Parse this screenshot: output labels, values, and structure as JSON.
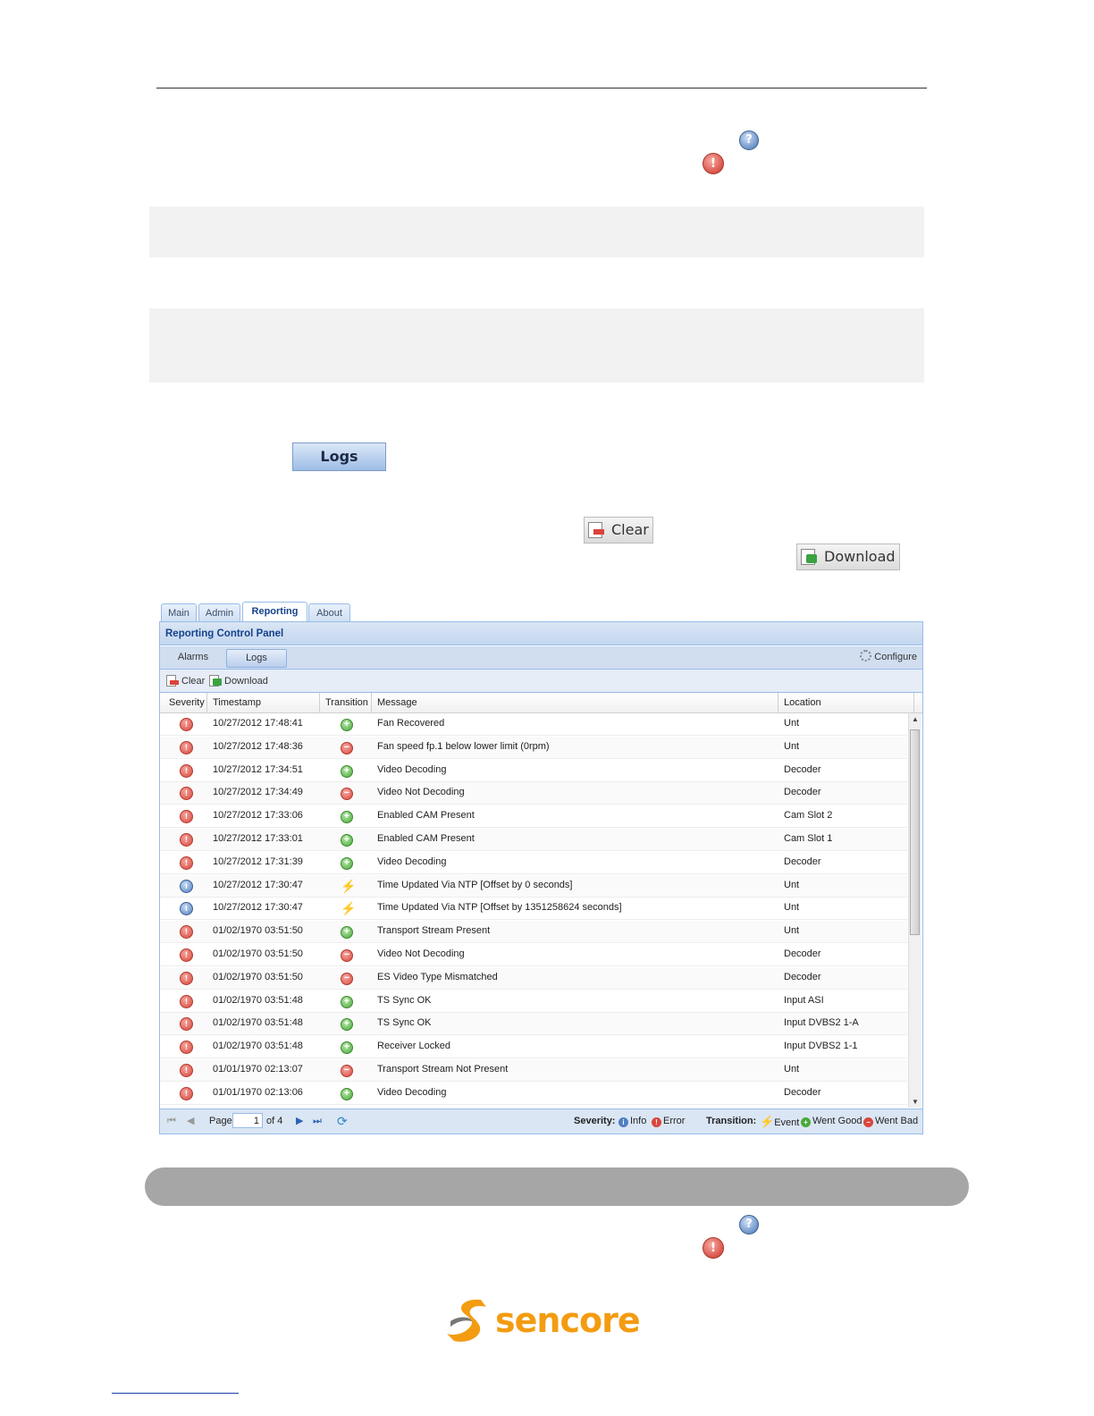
{
  "toolbar_buttons": {
    "logs_label": "Logs",
    "clear_label": "Clear",
    "download_label": "Download"
  },
  "icons": {
    "help": "help-icon",
    "alarm": "alarm-error-icon"
  },
  "panel": {
    "tabs": [
      "Main",
      "Admin",
      "Reporting",
      "About"
    ],
    "active_tab": "Reporting",
    "title": "Reporting Control Panel",
    "subtabs": [
      "Alarms",
      "Logs"
    ],
    "active_subtab": "Logs",
    "configure_label": "Configure",
    "clear_label": "Clear",
    "download_label": "Download",
    "columns": [
      "Severity",
      "Timestamp",
      "Transition",
      "Message",
      "Location"
    ],
    "rows": [
      {
        "severity": "error",
        "timestamp": "10/27/2012 17:48:41",
        "transition": "good",
        "message": "Fan Recovered",
        "location": "Unt"
      },
      {
        "severity": "error",
        "timestamp": "10/27/2012 17:48:36",
        "transition": "bad",
        "message": "Fan speed fp.1 below lower limit (0rpm)",
        "location": "Unt"
      },
      {
        "severity": "error",
        "timestamp": "10/27/2012 17:34:51",
        "transition": "good",
        "message": "Video Decoding",
        "location": "Decoder"
      },
      {
        "severity": "error",
        "timestamp": "10/27/2012 17:34:49",
        "transition": "bad",
        "message": "Video Not Decoding",
        "location": "Decoder"
      },
      {
        "severity": "error",
        "timestamp": "10/27/2012 17:33:06",
        "transition": "good",
        "message": "Enabled CAM Present",
        "location": "Cam Slot 2"
      },
      {
        "severity": "error",
        "timestamp": "10/27/2012 17:33:01",
        "transition": "good",
        "message": "Enabled CAM Present",
        "location": "Cam Slot 1"
      },
      {
        "severity": "error",
        "timestamp": "10/27/2012 17:31:39",
        "transition": "good",
        "message": "Video Decoding",
        "location": "Decoder"
      },
      {
        "severity": "info",
        "timestamp": "10/27/2012 17:30:47",
        "transition": "event",
        "message": "Time Updated Via NTP [Offset by 0 seconds]",
        "location": "Unt"
      },
      {
        "severity": "info",
        "timestamp": "10/27/2012 17:30:47",
        "transition": "event",
        "message": "Time Updated Via NTP [Offset by 1351258624 seconds]",
        "location": "Unt"
      },
      {
        "severity": "error",
        "timestamp": "01/02/1970 03:51:50",
        "transition": "good",
        "message": "Transport Stream Present",
        "location": "Unt"
      },
      {
        "severity": "error",
        "timestamp": "01/02/1970 03:51:50",
        "transition": "bad",
        "message": "Video Not Decoding",
        "location": "Decoder"
      },
      {
        "severity": "error",
        "timestamp": "01/02/1970 03:51:50",
        "transition": "bad",
        "message": "ES Video Type Mismatched",
        "location": "Decoder"
      },
      {
        "severity": "error",
        "timestamp": "01/02/1970 03:51:48",
        "transition": "good",
        "message": "TS Sync OK",
        "location": "Input ASI"
      },
      {
        "severity": "error",
        "timestamp": "01/02/1970 03:51:48",
        "transition": "good",
        "message": "TS Sync OK",
        "location": "Input DVBS2 1-A"
      },
      {
        "severity": "error",
        "timestamp": "01/02/1970 03:51:48",
        "transition": "good",
        "message": "Receiver Locked",
        "location": "Input DVBS2 1-1"
      },
      {
        "severity": "error",
        "timestamp": "01/01/1970 02:13:07",
        "transition": "bad",
        "message": "Transport Stream Not Present",
        "location": "Unt"
      },
      {
        "severity": "error",
        "timestamp": "01/01/1970 02:13:06",
        "transition": "good",
        "message": "Video Decoding",
        "location": "Decoder"
      }
    ],
    "pager": {
      "page_label": "Page",
      "page_value": "1",
      "of_label": "of 4"
    },
    "legend": {
      "severity_label": "Severity:",
      "info_label": "Info",
      "error_label": "Error",
      "transition_label": "Transition:",
      "event_label": "Event",
      "good_label": "Went Good",
      "bad_label": "Went Bad"
    }
  },
  "logo": {
    "text": "sencore.",
    "color": "#f39c12"
  }
}
